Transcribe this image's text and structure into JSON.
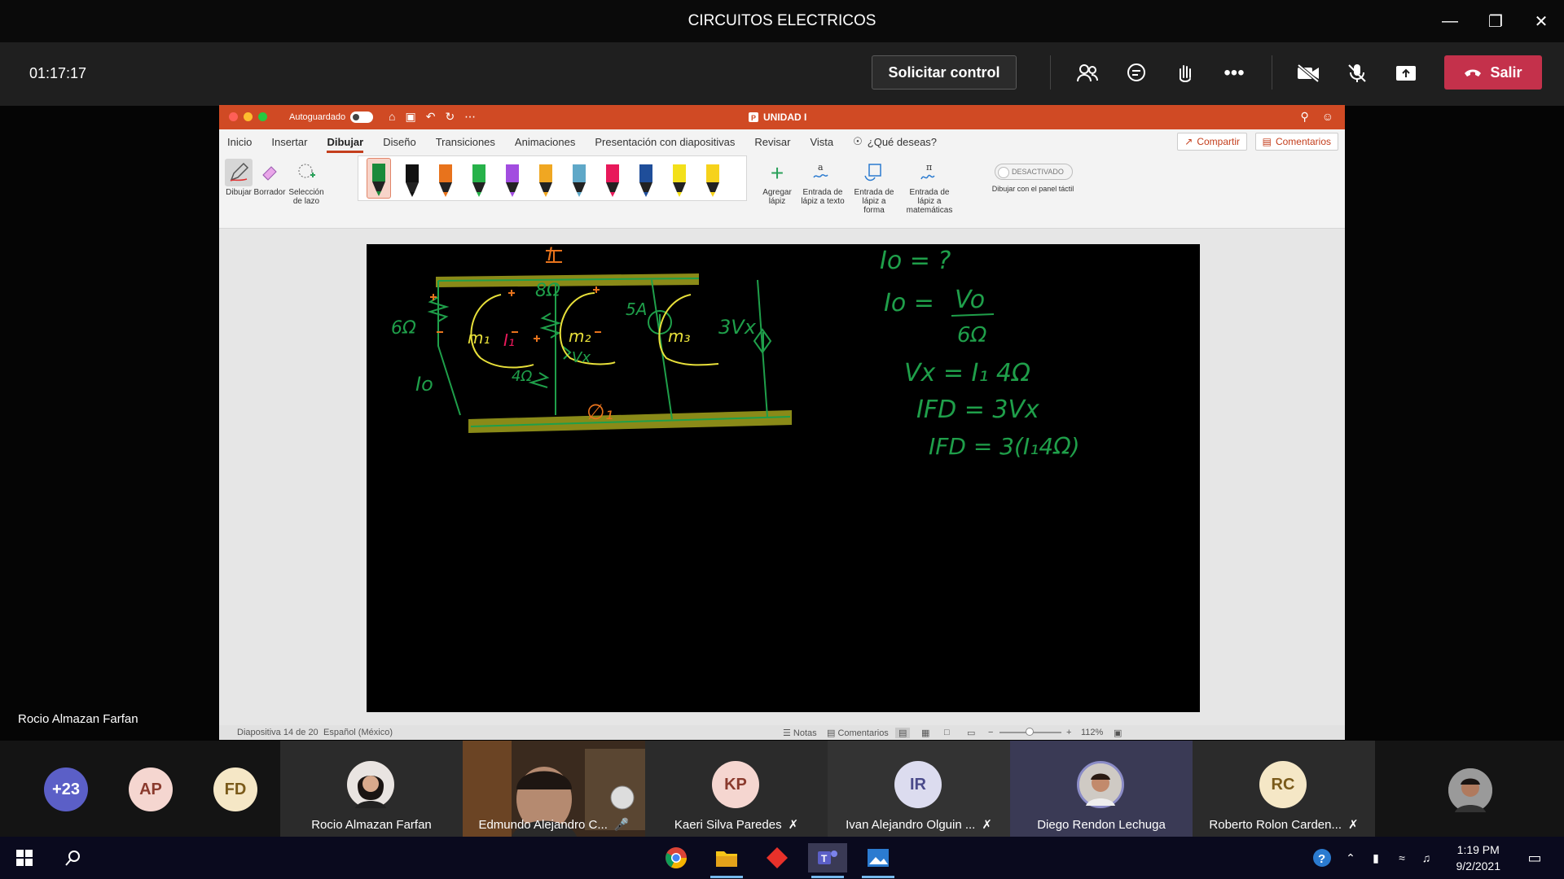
{
  "window": {
    "title": "CIRCUITOS ELECTRICOS"
  },
  "meeting": {
    "timer": "01:17:17",
    "request_control": "Solicitar control",
    "leave": "Salir",
    "presenter": "Rocio Almazan Farfan"
  },
  "ppt": {
    "autosave_label": "Autoguardado",
    "autosave_state": "O",
    "doc_title": "UNIDAD I",
    "tabs": [
      "Inicio",
      "Insertar",
      "Dibujar",
      "Diseño",
      "Transiciones",
      "Animaciones",
      "Presentación con diapositivas",
      "Revisar",
      "Vista"
    ],
    "active_tab": "Dibujar",
    "tell_me": "¿Qué deseas?",
    "share": "Compartir",
    "comments": "Comentarios",
    "tools": {
      "draw": "Dibujar",
      "eraser": "Borrador",
      "lasso": "Selección de lazo",
      "add_pen": "Agregar lápiz",
      "ink_text": "Entrada de lápiz a texto",
      "ink_shape": "Entrada de lápiz a forma",
      "ink_math": "Entrada de lápiz a matemáticas",
      "touch_toggle": "DESACTIVADO",
      "touch_label": "Dibujar con el panel táctil"
    },
    "pen_colors": [
      "#1b8a3a",
      "#111111",
      "#e8731c",
      "#27b24a",
      "#a24de0",
      "#f0a722",
      "#5fa8c8",
      "#e8195a",
      "#1f4e9a",
      "#f3e01a",
      "#f6d21b"
    ],
    "status": {
      "slide": "Diapositiva 14 de 20",
      "language": "Español (México)",
      "notes": "Notas",
      "comments": "Comentarios",
      "zoom": "112%"
    },
    "slide_ink": {
      "current": "I",
      "r1": "6Ω",
      "r2": "8Ω",
      "source": "5A",
      "dep_source": "3Vx",
      "r3": "4Ω",
      "vx": "Vx",
      "i1": "I₁",
      "io": "Io",
      "node": "∅₁",
      "mesh1": "m₁",
      "mesh2": "m₂",
      "mesh3": "m₃",
      "eq1": "Io = ?",
      "eq2_left": "Io =",
      "eq2_num": "Vo",
      "eq2_den": "6Ω",
      "eq3": "Vx = I₁ 4Ω",
      "eq4": "IFD = 3Vx",
      "eq5": "IFD = 3(I₁4Ω)"
    }
  },
  "participants": {
    "overflow": "+23",
    "avatars": [
      {
        "initials": "AP",
        "bg": "#f5d6d0",
        "fg": "#8a3a2d"
      },
      {
        "initials": "FD",
        "bg": "#f5e7c6",
        "fg": "#7a5a1a"
      }
    ],
    "tiles": [
      {
        "name": "Rocio Almazan Farfan",
        "kind": "photo"
      },
      {
        "name": "Edmundo Alejandro C...",
        "kind": "video"
      },
      {
        "name": "Kaeri Silva Paredes",
        "initials": "KP",
        "bg": "#f5d6d0",
        "fg": "#8a3a2d",
        "muted": true
      },
      {
        "name": "Ivan Alejandro Olguin ...",
        "initials": "IR",
        "bg": "#dcdcef",
        "fg": "#4a4a8a",
        "muted": true
      },
      {
        "name": "Diego Rendon Lechuga",
        "kind": "photo"
      },
      {
        "name": "Roberto Rolon Carden...",
        "initials": "RC",
        "bg": "#f5e7c6",
        "fg": "#7a5a1a",
        "muted": true
      }
    ]
  },
  "taskbar": {
    "time": "1:19 PM",
    "date": "9/2/2021"
  }
}
